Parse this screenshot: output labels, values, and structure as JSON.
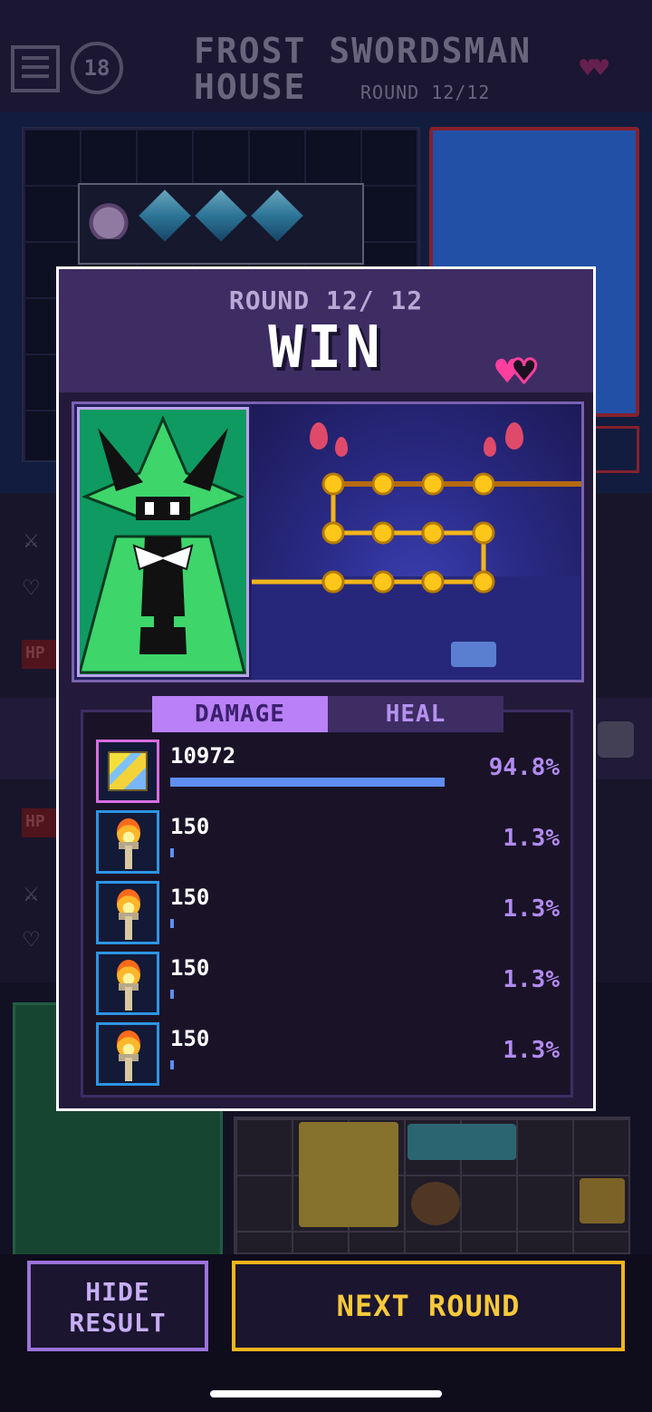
{
  "header": {
    "level": "18",
    "title_line1": "FROST SWORDSMAN",
    "title_line2": "HOUSE",
    "round": "ROUND 12/12",
    "lives_full": "♥",
    "lives_empty": "♥"
  },
  "modal": {
    "round_label": "ROUND 12/ 12",
    "result": "WIN",
    "hearts": {
      "full": "♥",
      "empty": "♥",
      "remaining": 1,
      "total": 2
    },
    "tabs": {
      "active": "DAMAGE",
      "damage_label": "DAMAGE",
      "heal_label": "HEAL"
    },
    "rows": [
      {
        "icon": "lightning-spell-icon",
        "value": "10972",
        "percent": "94.8%",
        "share": 0.948
      },
      {
        "icon": "torch-icon",
        "value": "150",
        "percent": "1.3%",
        "share": 0.013
      },
      {
        "icon": "torch-icon",
        "value": "150",
        "percent": "1.3%",
        "share": 0.013
      },
      {
        "icon": "torch-icon",
        "value": "150",
        "percent": "1.3%",
        "share": 0.013
      },
      {
        "icon": "torch-icon",
        "value": "150",
        "percent": "1.3%",
        "share": 0.013
      }
    ]
  },
  "sidebar_labels": {
    "hp_label": "HP"
  },
  "buttons": {
    "hide_line1": "HIDE",
    "hide_line2": "RESULT",
    "next_round": "NEXT ROUND"
  },
  "colors": {
    "accent_purple": "#b981f5",
    "heart_pink": "#ff3f9e",
    "bar_blue": "#5f8ef0",
    "next_border": "#f2b51c"
  }
}
